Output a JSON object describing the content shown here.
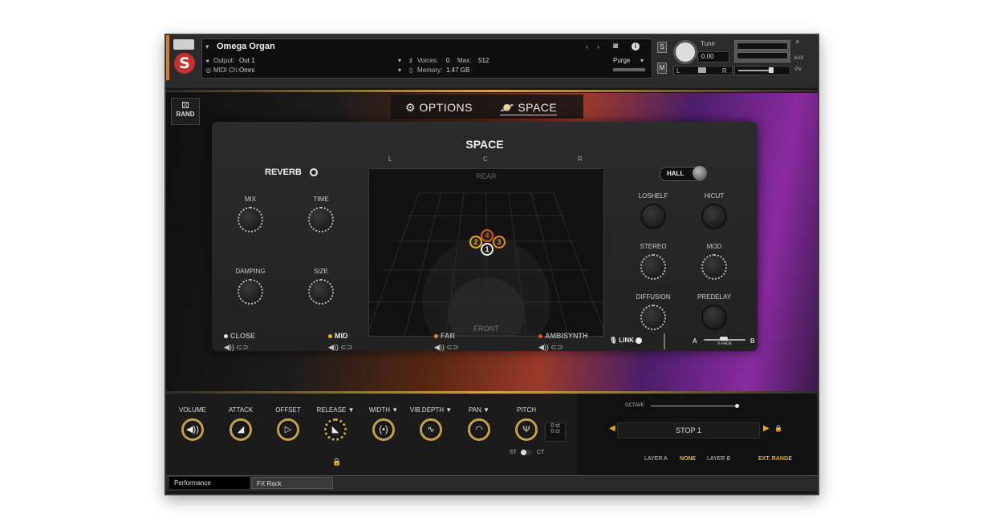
{
  "header": {
    "instrument_name": "Omega Organ",
    "output_label": "Output:",
    "output_value": "Out 1",
    "midi_label": "MIDI Ch:",
    "midi_value": "Omni",
    "voices_label": "Voices:",
    "voices_value": "0",
    "max_label": "Max:",
    "max_value": "512",
    "memory_label": "Memory:",
    "memory_value": "1.47 GB",
    "purge_label": "Purge",
    "solo_label": "S",
    "mute_label": "M",
    "tune_label": "Tune",
    "tune_value": "0.00",
    "pan_l": "L",
    "pan_r": "R",
    "close_label": "×",
    "aux_label": "AUX",
    "pv_label": "PV"
  },
  "top": {
    "rand_label": "RAND",
    "tab_options": "OPTIONS",
    "tab_space": "SPACE"
  },
  "space": {
    "title": "SPACE",
    "reverb_label": "REVERB",
    "field_l": "L",
    "field_c": "C",
    "field_r": "R",
    "field_rear": "REAR",
    "field_front": "FRONT",
    "markers": [
      "1",
      "2",
      "3",
      "4"
    ],
    "left_knobs": {
      "mix": "MIX",
      "time": "TIME",
      "damping": "DAMPING",
      "size": "SIZE"
    },
    "hall_label": "HALL",
    "right_knobs": {
      "loshelf": "LOSHELF",
      "hicut": "HICUT",
      "stereo": "STEREO",
      "mod": "MOD",
      "diffusion": "DIFFUSION",
      "predelay": "PREDELAY"
    }
  },
  "mics": {
    "close": "CLOSE",
    "mid": "MID",
    "far": "FAR",
    "ambisynth": "AMBISYNTH",
    "link": "LINK",
    "xfade_a": "A",
    "xfade_label": "X-FADE",
    "xfade_b": "B",
    "colors": {
      "close": "#e6e6e6",
      "mid": "#f0b400",
      "far": "#f08a1c",
      "ambisynth": "#e2541e"
    }
  },
  "performance": {
    "knobs": [
      "VOLUME",
      "ATTACK",
      "OFFSET",
      "RELEASE ▼",
      "WIDTH ▼",
      "VIB.DEPTH ▼",
      "PAN ▼",
      "PITCH"
    ],
    "pitch_oct": "0 st",
    "pitch_cent": "0 ct",
    "st_label": "ST",
    "ct_label": "CT",
    "octave_label": "OCTAVE",
    "stop_value": "STOP 1",
    "layer_a_label": "LAYER A",
    "layer_a_value": "NONE",
    "layer_b_label": "LAYER B",
    "ext_range_label": "EXT. RANGE"
  },
  "bottom_tabs": {
    "performance": "Performance",
    "fx_rack": "FX Rack"
  },
  "accent": "#d4a84b"
}
